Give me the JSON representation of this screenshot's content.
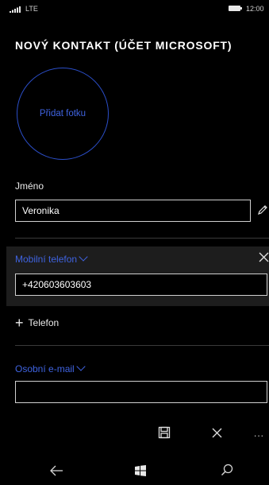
{
  "status_bar": {
    "network": "LTE",
    "time": "12:00"
  },
  "page": {
    "title": "NOVÝ KONTAKT (ÚČET MICROSOFT)"
  },
  "photo": {
    "label": "Přidat fotku"
  },
  "name_field": {
    "label": "Jméno",
    "value": "Veronika"
  },
  "phone": {
    "type_label": "Mobilní telefon",
    "value": "+420603603603"
  },
  "add_phone": {
    "label": "Telefon"
  },
  "email": {
    "type_label": "Osobní e-mail",
    "value": ""
  },
  "app_bar": {
    "icons": [
      "save-icon",
      "close-icon",
      "more-icon"
    ],
    "more_label": "..."
  },
  "nav_bar": {
    "icons": [
      "back-icon",
      "windows-icon",
      "search-icon"
    ]
  },
  "colors": {
    "accent": "#3f63e0",
    "background": "#000000",
    "section_highlight": "#1d1d1d"
  }
}
